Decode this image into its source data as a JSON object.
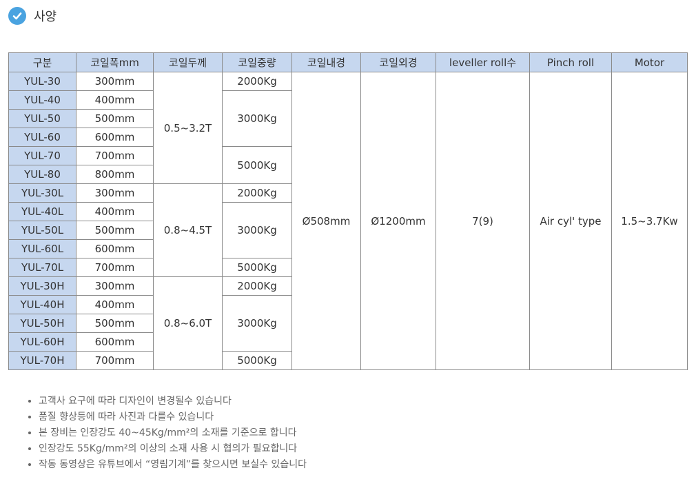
{
  "section": {
    "title": "사양",
    "icon": "check-circle-icon",
    "icon_color": "#4aa3e0"
  },
  "table": {
    "header_bg": "#c6d7ef",
    "headers": [
      "구분",
      "코일폭mm",
      "코일두께",
      "코일중량",
      "코일내경",
      "코일외경",
      "leveller roll수",
      "Pinch roll",
      "Motor"
    ],
    "models": [
      "YUL-30",
      "YUL-40",
      "YUL-50",
      "YUL-60",
      "YUL-70",
      "YUL-80",
      "YUL-30L",
      "YUL-40L",
      "YUL-50L",
      "YUL-60L",
      "YUL-70L",
      "YUL-30H",
      "YUL-40H",
      "YUL-50H",
      "YUL-60H",
      "YUL-70H"
    ],
    "widths": [
      "300mm",
      "400mm",
      "500mm",
      "600mm",
      "700mm",
      "800mm",
      "300mm",
      "400mm",
      "500mm",
      "600mm",
      "700mm",
      "300mm",
      "400mm",
      "500mm",
      "600mm",
      "700mm"
    ],
    "thickness": [
      "0.5~3.2T",
      "0.8~4.5T",
      "0.8~6.0T"
    ],
    "weights": [
      "2000Kg",
      "3000Kg",
      "5000Kg",
      "2000Kg",
      "3000Kg",
      "5000Kg",
      "2000Kg",
      "3000Kg",
      "5000Kg"
    ],
    "inner_diameter": "Ø508mm",
    "outer_diameter": "Ø1200mm",
    "leveller_rolls": "7(9)",
    "pinch_roll": "Air cyl' type",
    "motor": "1.5~3.7Kw"
  },
  "notes": [
    "고객사 요구에 따라 디자인이 변경될수 있습니다",
    "품질 향상등에 따라 사진과 다를수 있습니다",
    "본 장비는 인장강도 40~45Kg/mm²의 소재를 기준으로 합니다",
    "인장강도 55Kg/mm²의 이상의 소재 사용 시 협의가 필요합니다",
    "작동 동영상은 유튜브에서 “영림기계”를 찾으시면 보실수 있습니다"
  ]
}
